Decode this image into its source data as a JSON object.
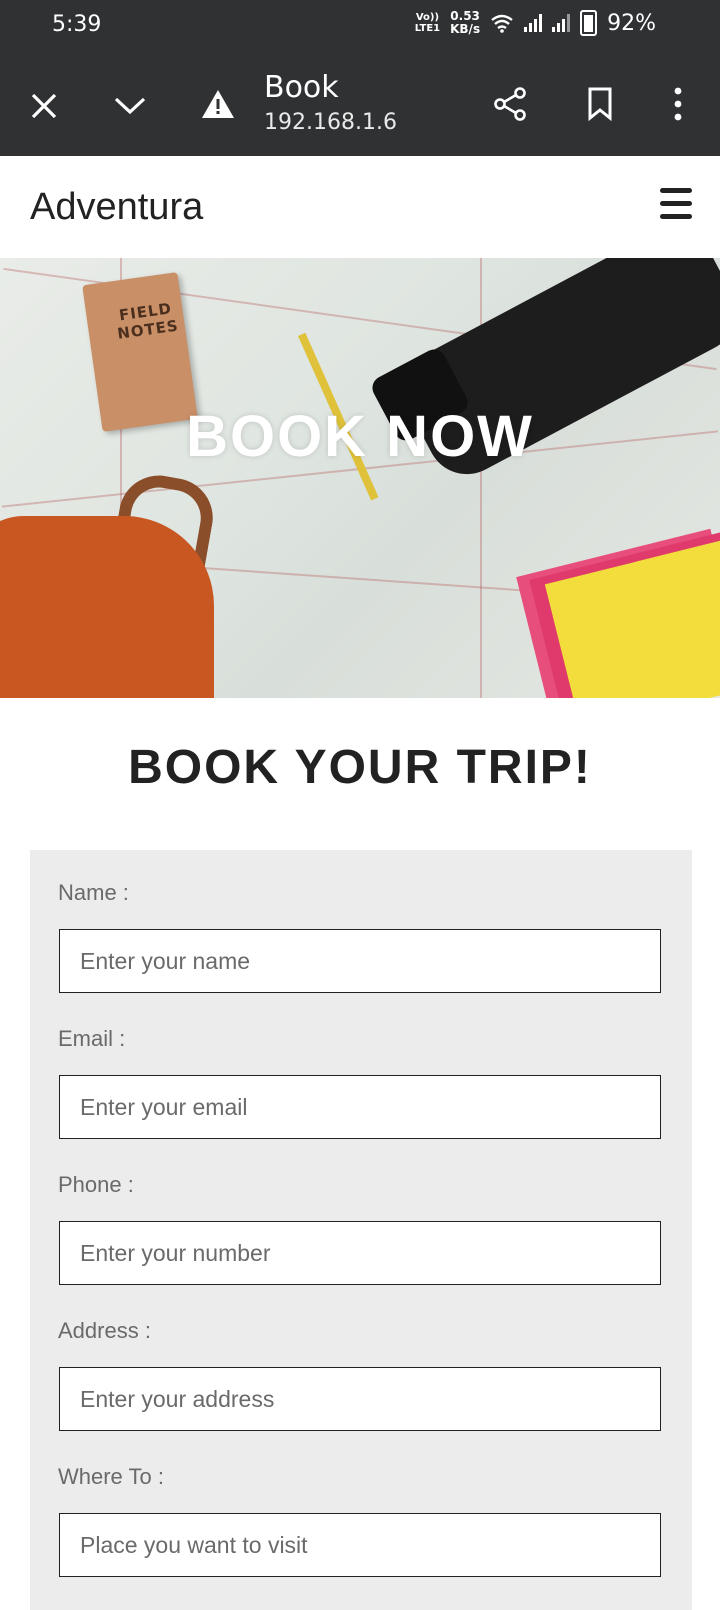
{
  "status_bar": {
    "time": "5:39",
    "net_type_top": "Vo))",
    "net_type_bottom": "LTE1",
    "speed_value": "0.53",
    "speed_unit": "KB/s",
    "battery": "92%"
  },
  "browser": {
    "title": "Book",
    "url": "192.168.1.6",
    "icons": [
      "close-icon",
      "chevron-down-icon",
      "warning-icon",
      "share-icon",
      "bookmark-icon",
      "more-vert-icon"
    ]
  },
  "site": {
    "brand": "Adventura"
  },
  "hero": {
    "title": "BOOK NOW",
    "notebook_text": "FIELD NOTES"
  },
  "main": {
    "heading": "BOOK YOUR TRIP!",
    "form": {
      "name_label": "Name :",
      "name_placeholder": "Enter your name",
      "email_label": "Email :",
      "email_placeholder": "Enter your email",
      "phone_label": "Phone :",
      "phone_placeholder": "Enter your number",
      "address_label": "Address :",
      "address_placeholder": "Enter your address",
      "where_label": "Where To :",
      "where_placeholder": "Place you want to visit"
    }
  },
  "colors": {
    "chrome_bg": "#2f3133",
    "form_bg": "#ececec",
    "text_dark": "#222222"
  }
}
